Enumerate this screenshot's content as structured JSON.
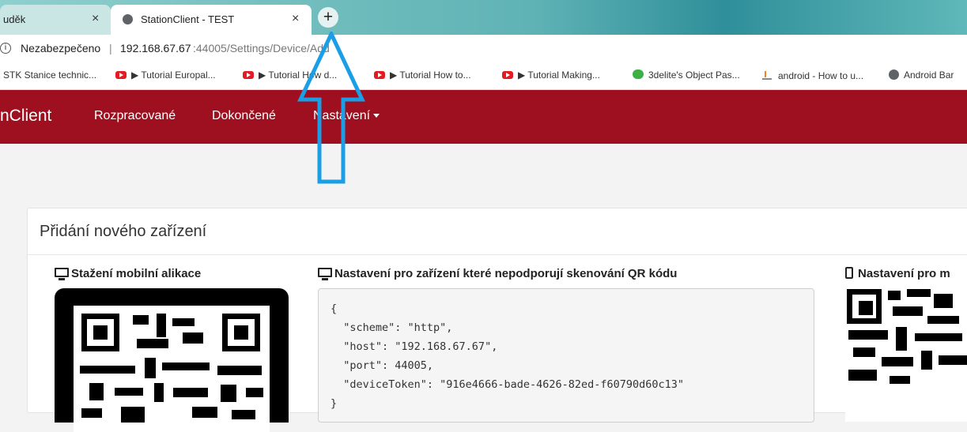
{
  "browser": {
    "tabs": [
      {
        "title": "uděk",
        "active": false
      },
      {
        "title": "StationClient - TEST",
        "active": true
      }
    ],
    "close_glyph": "×",
    "new_tab_glyph": "+",
    "address": {
      "security_label": "Nezabezpečeno",
      "separator": "|",
      "host": "192.168.67.67",
      "path": ":44005/Settings/Device/Add"
    },
    "bookmarks": [
      {
        "label": "STK Stanice technic...",
        "icon": "page-icon"
      },
      {
        "label": "▶ Tutorial Europal...",
        "icon": "youtube-icon"
      },
      {
        "label": "▶ Tutorial How d...",
        "icon": "youtube-icon"
      },
      {
        "label": "▶ Tutorial How to...",
        "icon": "youtube-icon"
      },
      {
        "label": "▶ Tutorial Making...",
        "icon": "youtube-icon"
      },
      {
        "label": "3delite's Object Pas...",
        "icon": "eye-icon"
      },
      {
        "label": "android - How to u...",
        "icon": "stackoverflow-icon"
      },
      {
        "label": "Android Bar",
        "icon": "globe-icon"
      }
    ]
  },
  "navbar": {
    "brand": "nClient",
    "items": [
      "Rozpracované",
      "Dokončené",
      "Nastavení"
    ],
    "color": "#9e1020"
  },
  "card": {
    "title": "Přidání nového zařízení",
    "col1_title": "Stažení mobilní alikace",
    "col2_title": "Nastavení pro zařízení které nepodporují skenování QR kódu",
    "col3_title": "Nastavení pro m",
    "json_lines": [
      "{",
      "  \"scheme\": \"http\",",
      "  \"host\": \"192.168.67.67\",",
      "  \"port\": 44005,",
      "  \"deviceToken\": \"916e4666-bade-4626-82ed-f60790d60c13\"",
      "}"
    ]
  },
  "annotation": {
    "arrow_color": "#1a9ee6",
    "arrow_direction": "up"
  }
}
